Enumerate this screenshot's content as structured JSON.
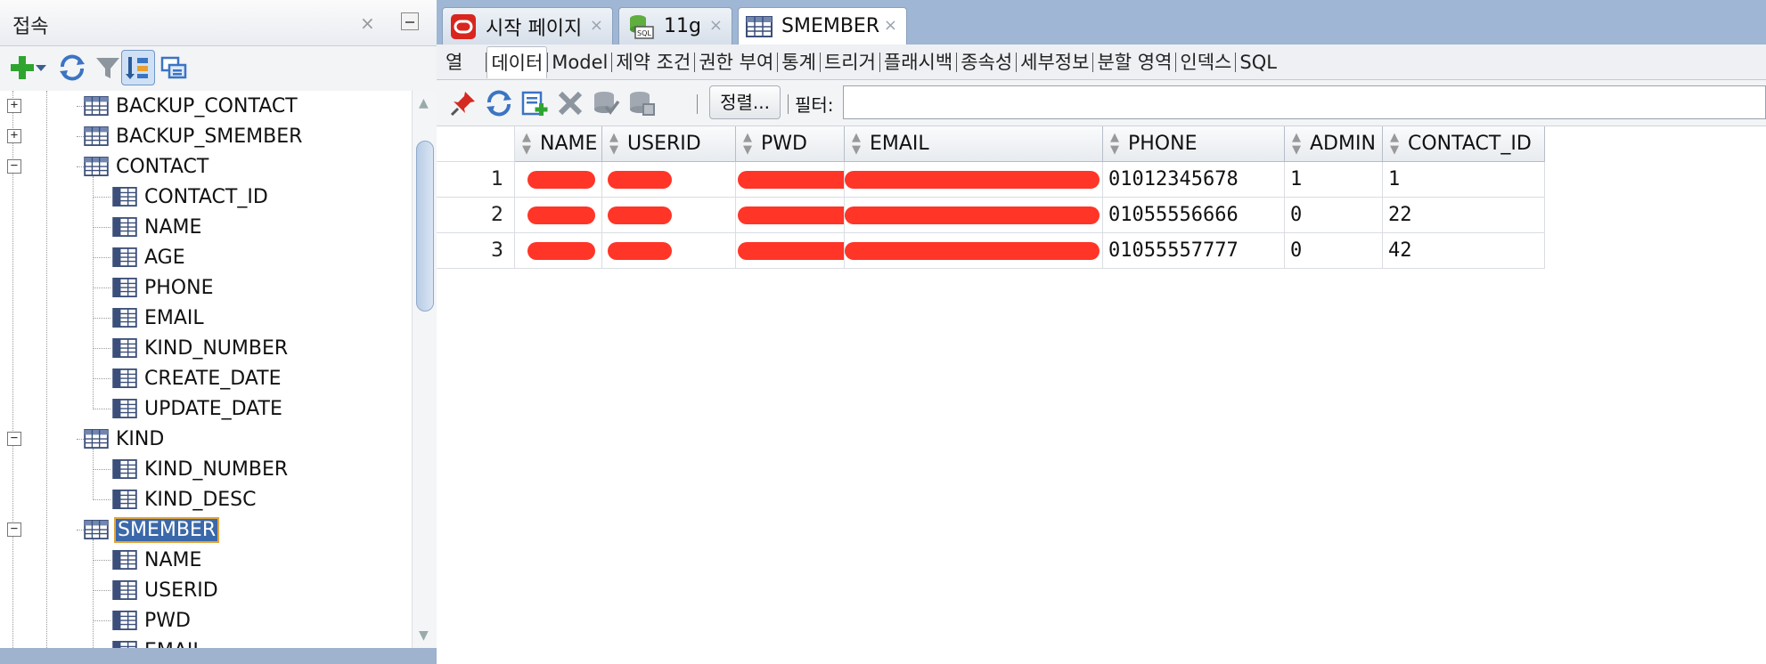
{
  "left_panel": {
    "title": "접속",
    "close_glyph": "×",
    "toolbar": [
      {
        "name": "add-connection-icon"
      },
      {
        "name": "dropdown-arrow-icon"
      },
      {
        "name": "refresh-icon"
      },
      {
        "name": "filter-icon"
      },
      {
        "name": "schema-browser-icon"
      },
      {
        "name": "manage-icon"
      }
    ],
    "tree": [
      {
        "label": "BACKUP_CONTACT",
        "level": 1,
        "expander": "+"
      },
      {
        "label": "BACKUP_SMEMBER",
        "level": 1,
        "expander": "+"
      },
      {
        "label": "CONTACT",
        "level": 1,
        "expander": "−"
      },
      {
        "label": "CONTACT_ID",
        "level": 2
      },
      {
        "label": "NAME",
        "level": 2
      },
      {
        "label": "AGE",
        "level": 2
      },
      {
        "label": "PHONE",
        "level": 2
      },
      {
        "label": "EMAIL",
        "level": 2
      },
      {
        "label": "KIND_NUMBER",
        "level": 2
      },
      {
        "label": "CREATE_DATE",
        "level": 2
      },
      {
        "label": "UPDATE_DATE",
        "level": 2
      },
      {
        "label": "KIND",
        "level": 1,
        "expander": "−"
      },
      {
        "label": "KIND_NUMBER",
        "level": 2
      },
      {
        "label": "KIND_DESC",
        "level": 2
      },
      {
        "label": "SMEMBER",
        "level": 1,
        "expander": "−",
        "selected": true
      },
      {
        "label": "NAME",
        "level": 2
      },
      {
        "label": "USERID",
        "level": 2
      },
      {
        "label": "PWD",
        "level": 2
      },
      {
        "label": "EMAIL",
        "level": 2
      }
    ]
  },
  "doc_tabs": [
    {
      "label": "시작 페이지",
      "icon": "oracle-icon",
      "active": false
    },
    {
      "label": "11g",
      "icon": "sql-connection-icon",
      "active": false
    },
    {
      "label": "SMEMBER",
      "icon": "table-icon",
      "active": true
    }
  ],
  "close_glyph": "×",
  "sub_tabs": [
    "열",
    "데이터",
    "Model",
    "제약 조건",
    "권한 부여",
    "통계",
    "트리거",
    "플래시백",
    "종속성",
    "세부정보",
    "분할 영역",
    "인덱스",
    "SQL"
  ],
  "active_sub_tab": "데이터",
  "data_toolbar": {
    "icons": [
      "pin-icon",
      "refresh-icon",
      "insert-row-icon",
      "delete-row-icon",
      "commit-icon",
      "rollback-icon"
    ],
    "sort_label": "정렬...",
    "filter_label": "필터:",
    "filter_value": ""
  },
  "grid": {
    "columns": [
      "NAME",
      "USERID",
      "PWD",
      "EMAIL",
      "PHONE",
      "ADMIN",
      "CONTACT_ID"
    ],
    "rows": [
      {
        "num": "1",
        "cells": [
          "",
          "",
          "",
          "",
          "01012345678",
          "1",
          "1"
        ]
      },
      {
        "num": "2",
        "cells": [
          "",
          "",
          "",
          "",
          "01055556666",
          "0",
          "22"
        ]
      },
      {
        "num": "3",
        "cells": [
          "",
          "",
          "",
          "",
          "01055557777",
          "0",
          "42"
        ]
      }
    ]
  },
  "colors": {
    "selection": "#3b68a9",
    "redaction": "#ff2a1c",
    "tab_strip": "#9fb6d4"
  }
}
